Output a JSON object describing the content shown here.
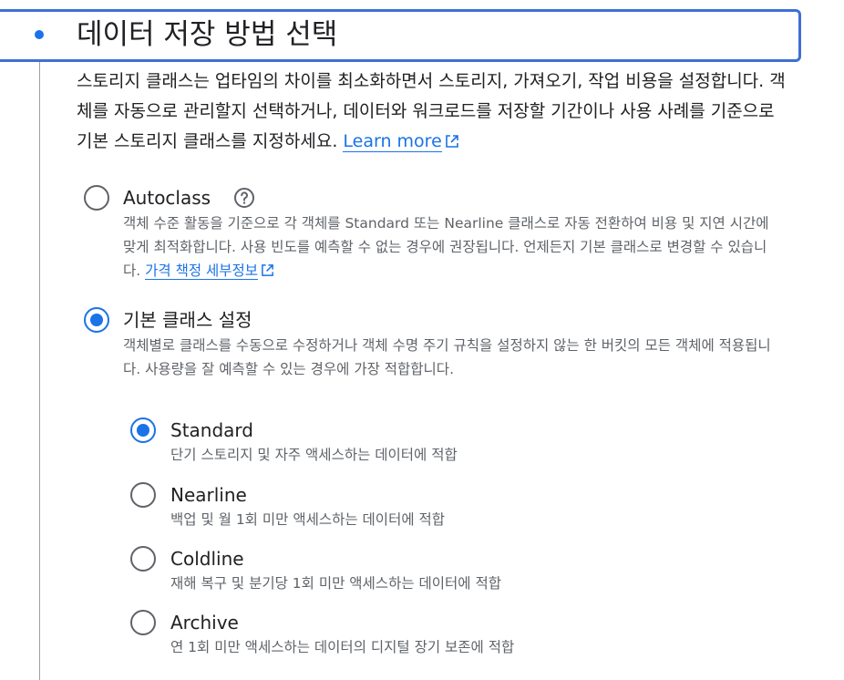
{
  "section": {
    "title": "데이터 저장 방법 선택",
    "description": "스토리지 클래스는 업타임의 차이를 최소화하면서 스토리지, 가져오기, 작업 비용을 설정합니다. 객체를 자동으로 관리할지 선택하거나, 데이터와 워크로드를 저장할 기간이나 사용 사례를 기준으로 기본 스토리지 클래스를 지정하세요.",
    "learn_more": "Learn more"
  },
  "autoclass": {
    "label": "Autoclass",
    "selected": false,
    "description": "객체 수준 활동을 기준으로 각 객체를 Standard 또는 Nearline 클래스로 자동 전환하여 비용 및 지연 시간에 맞게 최적화합니다. 사용 빈도를 예측할 수 없는 경우에 권장됩니다. 언제든지 기본 클래스로 변경할 수 있습니다.",
    "link": "가격 책정 세부정보",
    "help_icon": "help-circle-icon"
  },
  "default_class": {
    "label": "기본 클래스 설정",
    "selected": true,
    "description": "객체별로 클래스를 수동으로 수정하거나 객체 수명 주기 규칙을 설정하지 않는 한 버킷의 모든 객체에 적용됩니다. 사용량을 잘 예측할 수 있는 경우에 가장 적합합니다."
  },
  "classes": [
    {
      "label": "Standard",
      "selected": true,
      "description": "단기 스토리지 및 자주 액세스하는 데이터에 적합"
    },
    {
      "label": "Nearline",
      "selected": false,
      "description": "백업 및 월 1회 미만 액세스하는 데이터에 적합"
    },
    {
      "label": "Coldline",
      "selected": false,
      "description": "재해 복구 및 분기당 1회 미만 액세스하는 데이터에 적합"
    },
    {
      "label": "Archive",
      "selected": false,
      "description": "연 1회 미만 액세스하는 데이터의 디지털 장기 보존에 적합"
    }
  ],
  "colors": {
    "accent": "#1a73e8",
    "focus_border": "#3e6fd6",
    "text": "#202124",
    "secondary_text": "#5f6368"
  }
}
